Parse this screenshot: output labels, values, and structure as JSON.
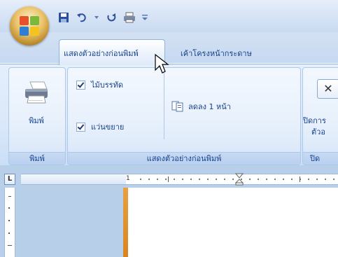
{
  "tabs": {
    "print_preview": "แสดงตัวอย่างก่อนพิมพ์",
    "page_layout": "เค้าโครงหน้ากระดาษ"
  },
  "ribbon": {
    "print_group": {
      "print_label": "พิมพ์",
      "footer": "พิมพ์"
    },
    "preview_group": {
      "ruler_label": "ไม้บรรทัด",
      "magnifier_label": "แว่นขยาย",
      "shrink_label": "ลดลง 1 หน้า",
      "footer": "แสดงตัวอย่างก่อนพิมพ์"
    },
    "close_group": {
      "close_label_line1": "ปิดการ",
      "close_label_line2": "ตัวอ",
      "footer": "ปิด"
    }
  },
  "ruler": {
    "corner_glyph": "L",
    "first_mark": "1"
  },
  "colors": {
    "ribbon_text": "#15428b",
    "accent_orange": "#d88520"
  }
}
